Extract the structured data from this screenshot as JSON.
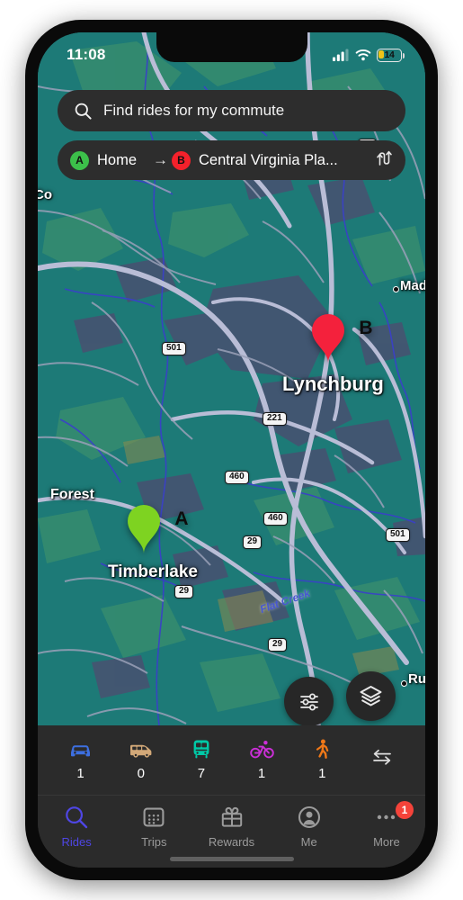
{
  "status_bar": {
    "time": "11:08",
    "cellular_icon": "cellular-signal-icon",
    "wifi_icon": "wifi-icon",
    "battery_level": "14"
  },
  "search": {
    "placeholder": "Find rides for my commute",
    "icon": "search-icon"
  },
  "route": {
    "origin_badge": "A",
    "origin": "Home",
    "arrow": "→",
    "dest_badge": "B",
    "dest": "Central Virginia Pla...",
    "swap_icon": "swap-route-icon"
  },
  "map": {
    "background_color": "#1d7a77",
    "pins": [
      {
        "letter": "A",
        "label": "Timberlake",
        "color": "#7ed321"
      },
      {
        "letter": "B",
        "label": "Lynchburg",
        "color": "#f4213c"
      }
    ],
    "place_labels": [
      {
        "name": "Co",
        "truncated": true
      },
      {
        "name": "Madi",
        "truncated": true
      },
      {
        "name": "Forest",
        "truncated": false
      },
      {
        "name": "Lynchburg",
        "truncated": false
      },
      {
        "name": "Timberlake",
        "truncated": false
      },
      {
        "name": "Ru",
        "truncated": true
      }
    ],
    "water_labels": [
      "Flat Creek"
    ],
    "highway_shields": [
      "501",
      "221",
      "460",
      "460",
      "29",
      "501",
      "29",
      "29"
    ],
    "controls": [
      {
        "name": "filter-button",
        "icon": "sliders-icon"
      },
      {
        "name": "layers-button",
        "icon": "layers-icon"
      }
    ]
  },
  "mode_bar": {
    "modes": [
      {
        "id": "car",
        "icon": "car-icon",
        "count": "1",
        "color": "#3d6fe0"
      },
      {
        "id": "van",
        "icon": "van-icon",
        "count": "0",
        "color": "#d2a878"
      },
      {
        "id": "transit",
        "icon": "train-icon",
        "count": "7",
        "color": "#00c9a7"
      },
      {
        "id": "bike",
        "icon": "bike-icon",
        "count": "1",
        "color": "#cc2fd8"
      },
      {
        "id": "walk",
        "icon": "walk-icon",
        "count": "1",
        "color": "#f07818"
      },
      {
        "id": "swap",
        "icon": "swap-arrows-icon",
        "count": "",
        "color": "#e0e0e0"
      }
    ]
  },
  "tab_bar": {
    "active_color": "#4f46e5",
    "inactive_color": "#9b9b9b",
    "tabs": [
      {
        "id": "rides",
        "label": "Rides",
        "icon": "search-icon",
        "active": true,
        "badge": ""
      },
      {
        "id": "trips",
        "label": "Trips",
        "icon": "calendar-icon",
        "active": false,
        "badge": ""
      },
      {
        "id": "rewards",
        "label": "Rewards",
        "icon": "gift-icon",
        "active": false,
        "badge": ""
      },
      {
        "id": "me",
        "label": "Me",
        "icon": "person-icon",
        "active": false,
        "badge": ""
      },
      {
        "id": "more",
        "label": "More",
        "icon": "ellipsis-icon",
        "active": false,
        "badge": "1"
      }
    ]
  }
}
